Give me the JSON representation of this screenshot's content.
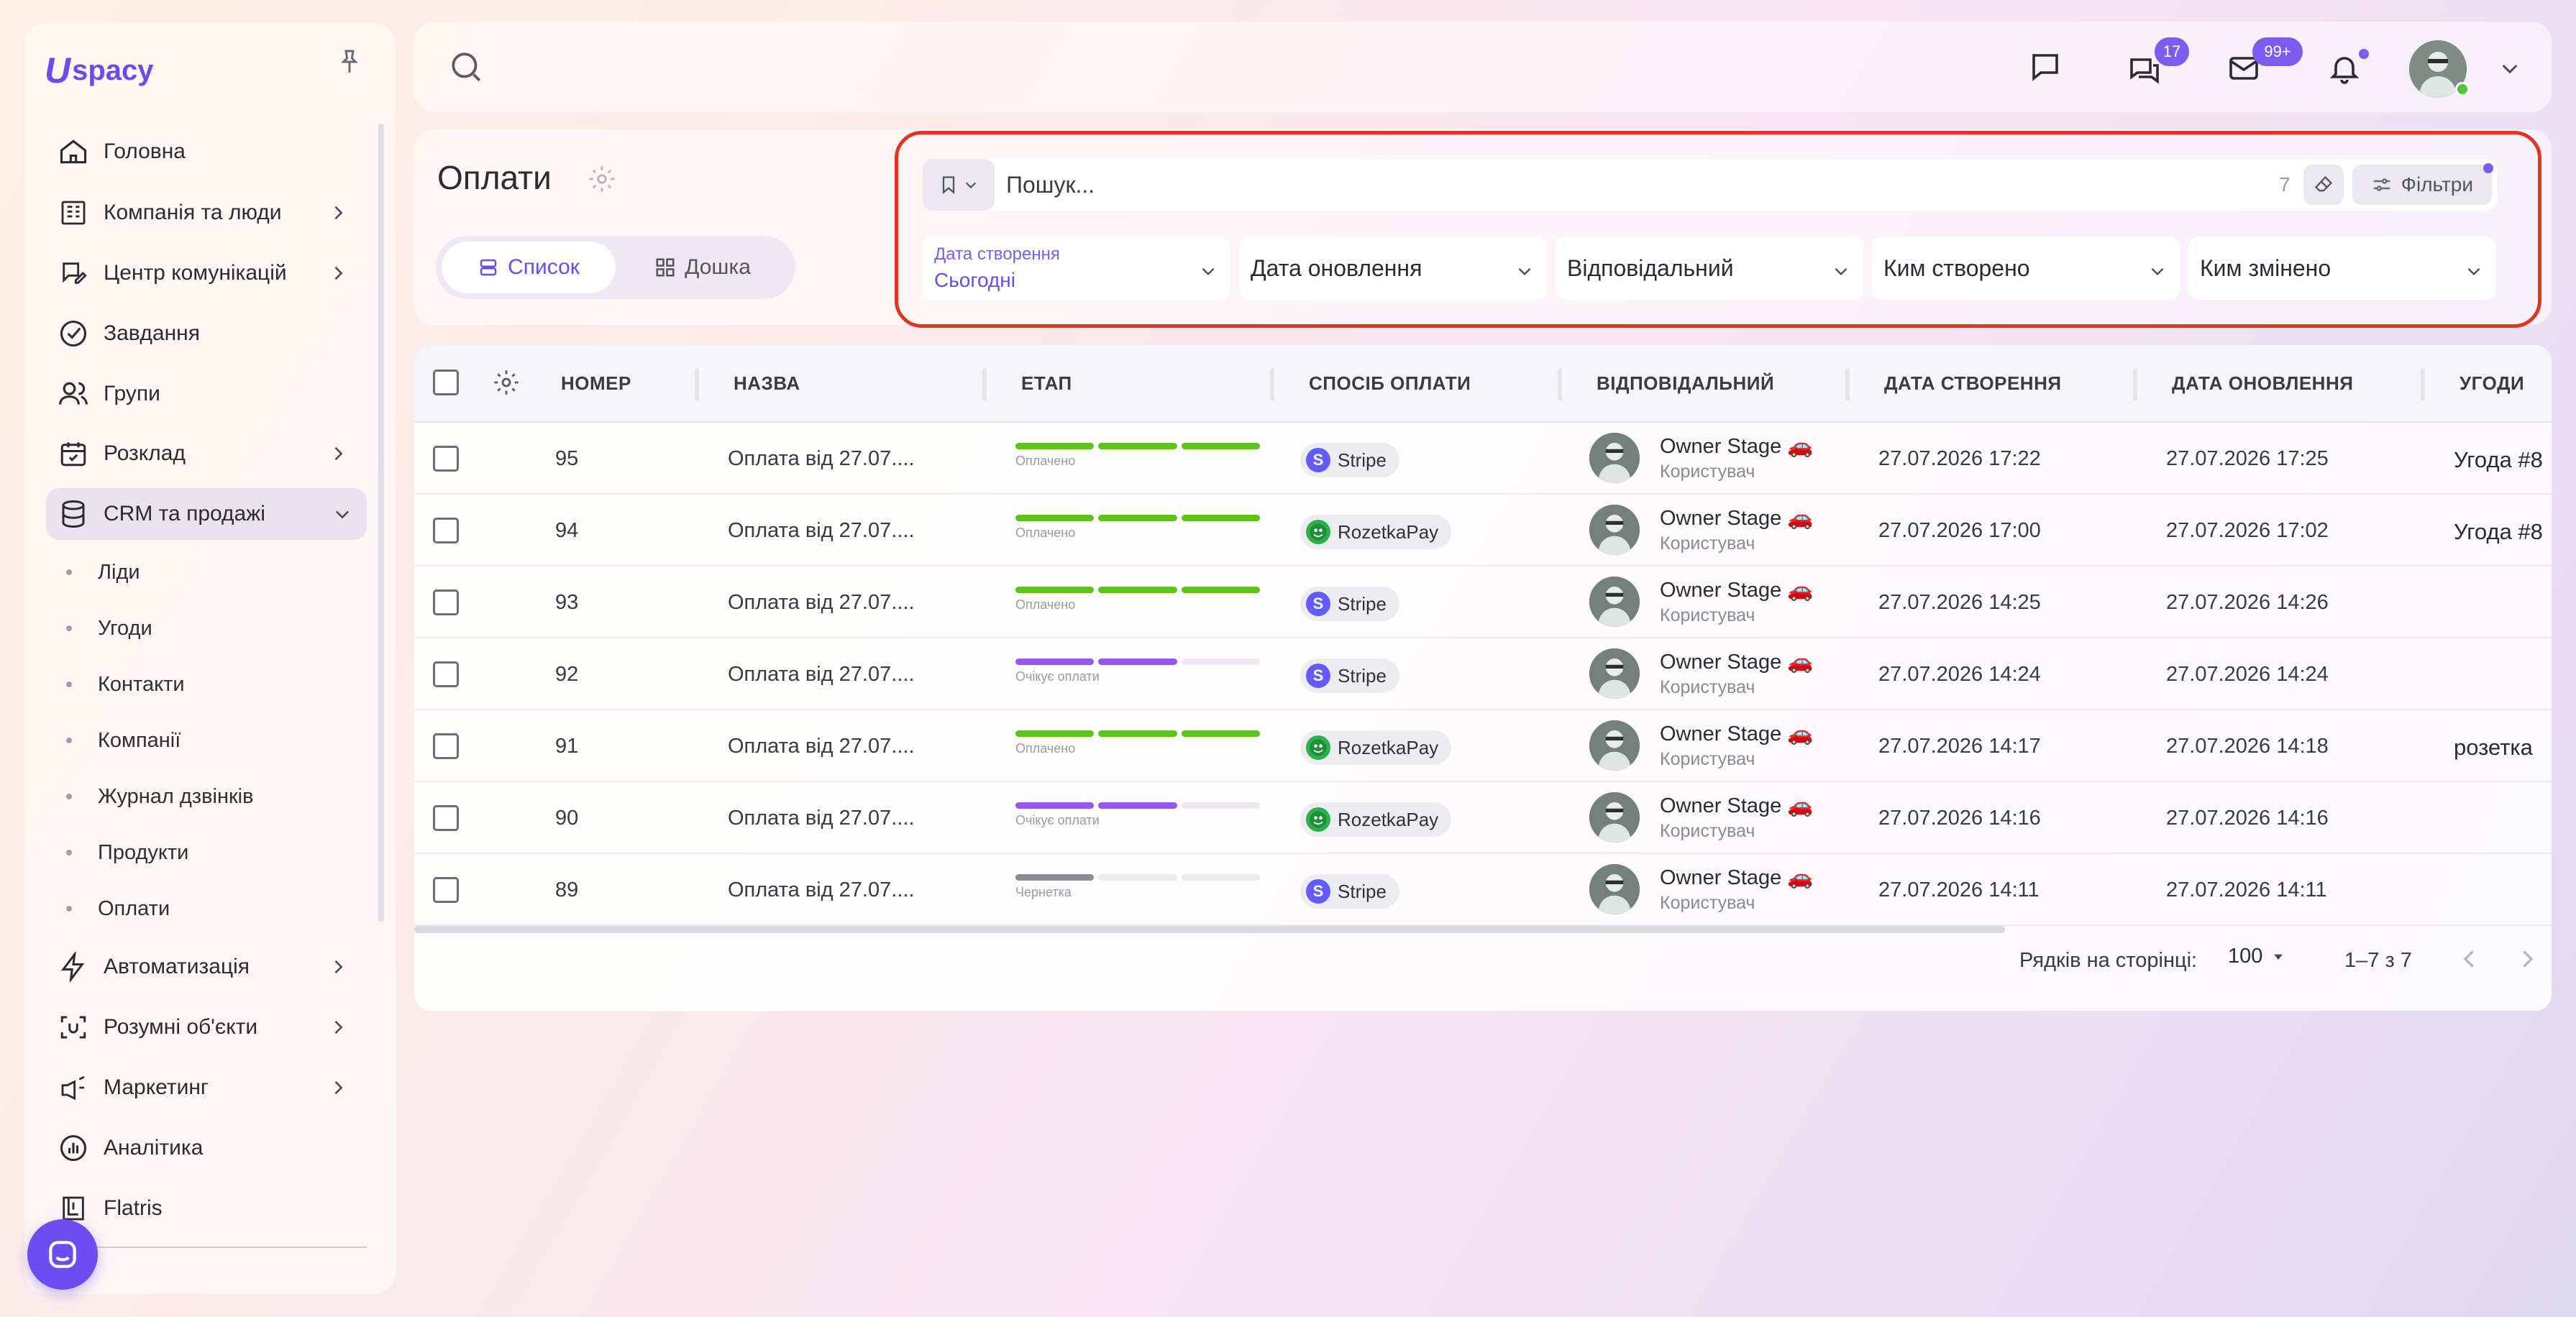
{
  "brand": {
    "logo_letter": "U",
    "logo_word": "spacy"
  },
  "sidebar": {
    "items": [
      {
        "label": "Головна",
        "icon": "home-icon"
      },
      {
        "label": "Компанія та люди",
        "icon": "building-icon"
      },
      {
        "label": "Центр комунікацій",
        "icon": "chat-edit-icon"
      },
      {
        "label": "Завдання",
        "icon": "check-circle-icon"
      },
      {
        "label": "Групи",
        "icon": "group-icon"
      },
      {
        "label": "Розклад",
        "icon": "calendar-icon"
      },
      {
        "label": "CRM та продажі",
        "icon": "database-icon"
      },
      {
        "label": "Автоматизація",
        "icon": "lightning-icon"
      },
      {
        "label": "Розумні об'єкти",
        "icon": "scan-icon"
      },
      {
        "label": "Маркетинг",
        "icon": "megaphone-icon"
      },
      {
        "label": "Аналітика",
        "icon": "analytics-icon"
      },
      {
        "label": "Flatris",
        "icon": "game-icon"
      }
    ],
    "crm_sub": [
      "Ліди",
      "Угоди",
      "Контакти",
      "Компанії",
      "Журнал дзвінків",
      "Продукти",
      "Оплати"
    ]
  },
  "topbar": {
    "messages_badge": "17",
    "mail_badge": "99+"
  },
  "page": {
    "title": "Оплати",
    "view_list": "Список",
    "view_board": "Дошка",
    "search_placeholder": "Пошук...",
    "search_count": "7",
    "filters_label": "Фільтри",
    "dropdowns": {
      "created_label": "Дата створення",
      "created_value": "Сьогодні",
      "updated": "Дата оновлення",
      "responsible": "Відповідальний",
      "created_by": "Ким створено",
      "modified_by": "Ким змінено"
    }
  },
  "table": {
    "headers": {
      "number": "НОМЕР",
      "name": "НАЗВА",
      "stage": "ЕТАП",
      "method": "СПОСІБ ОПЛАТИ",
      "responsible": "ВІДПОВІДАЛЬНИЙ",
      "created": "ДАТА СТВОРЕННЯ",
      "updated": "ДАТА ОНОВЛЕННЯ",
      "deals": "УГОДИ"
    },
    "rows": [
      {
        "num": "95",
        "name": "Оплата від 27.07....",
        "stage": "Оплачено",
        "stage_kind": "paid",
        "method": "Stripe",
        "user": "Owner Stage 🚗",
        "role": "Користувач",
        "created": "27.07.2026 17:22",
        "updated": "27.07.2026 17:25",
        "deal": "Угода #8"
      },
      {
        "num": "94",
        "name": "Оплата від 27.07....",
        "stage": "Оплачено",
        "stage_kind": "paid",
        "method": "RozetkaPay",
        "user": "Owner Stage 🚗",
        "role": "Користувач",
        "created": "27.07.2026 17:00",
        "updated": "27.07.2026 17:02",
        "deal": "Угода #8"
      },
      {
        "num": "93",
        "name": "Оплата від 27.07....",
        "stage": "Оплачено",
        "stage_kind": "paid",
        "method": "Stripe",
        "user": "Owner Stage 🚗",
        "role": "Користувач",
        "created": "27.07.2026 14:25",
        "updated": "27.07.2026 14:26",
        "deal": ""
      },
      {
        "num": "92",
        "name": "Оплата від 27.07....",
        "stage": "Очікує оплати",
        "stage_kind": "waiting",
        "method": "Stripe",
        "user": "Owner Stage 🚗",
        "role": "Користувач",
        "created": "27.07.2026 14:24",
        "updated": "27.07.2026 14:24",
        "deal": ""
      },
      {
        "num": "91",
        "name": "Оплата від 27.07....",
        "stage": "Оплачено",
        "stage_kind": "paid",
        "method": "RozetkaPay",
        "user": "Owner Stage 🚗",
        "role": "Користувач",
        "created": "27.07.2026 14:17",
        "updated": "27.07.2026 14:18",
        "deal": "розетка"
      },
      {
        "num": "90",
        "name": "Оплата від 27.07....",
        "stage": "Очікує оплати",
        "stage_kind": "waiting",
        "method": "RozetkaPay",
        "user": "Owner Stage 🚗",
        "role": "Користувач",
        "created": "27.07.2026 14:16",
        "updated": "27.07.2026 14:16",
        "deal": ""
      },
      {
        "num": "89",
        "name": "Оплата від 27.07....",
        "stage": "Чернетка",
        "stage_kind": "draft",
        "method": "Stripe",
        "user": "Owner Stage 🚗",
        "role": "Користувач",
        "created": "27.07.2026 14:11",
        "updated": "27.07.2026 14:11",
        "deal": ""
      }
    ],
    "footer": {
      "rows_per_page_label": "Рядків на сторінці:",
      "rows_per_page": "100",
      "range": "1–7 з 7"
    }
  },
  "colors": {
    "accent": "#6a4bf0",
    "paid": "#5cc21c",
    "waiting": "#9557e8",
    "draft": "#8c8c92",
    "highlight": "#e1351f"
  }
}
